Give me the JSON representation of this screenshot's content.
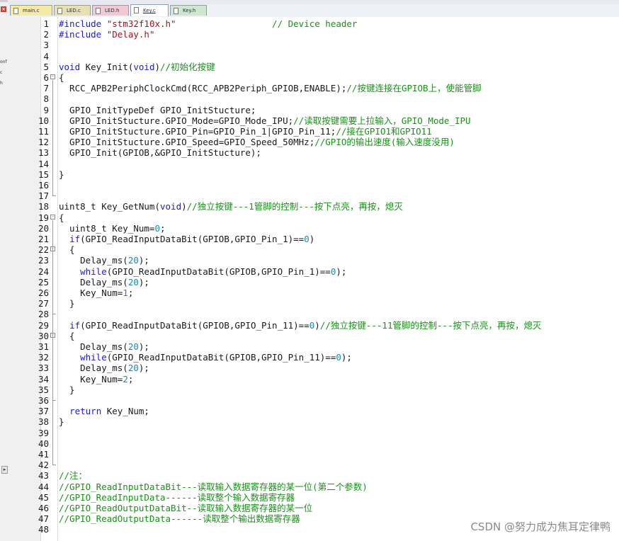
{
  "tabs": [
    {
      "label": "main.c",
      "color": "#f4e9a6",
      "active": false
    },
    {
      "label": "LED.c",
      "color": "#e7e0b3",
      "active": false
    },
    {
      "label": "LED.h",
      "color": "#f1c9d3",
      "active": false
    },
    {
      "label": "Key.c",
      "color": "#c9ddf1",
      "active": true
    },
    {
      "label": "Key.h",
      "color": "#cfe7d0",
      "active": false
    }
  ],
  "left_pane": {
    "close_icon": "×",
    "cut_labels": [
      "onf",
      "c",
      "h"
    ],
    "expand_arrow": "▸"
  },
  "code_lines": [
    {
      "n": "1",
      "segs": [
        [
          "kw",
          "#include "
        ],
        [
          "str",
          "\"stm32f10x.h\""
        ],
        [
          "",
          "                  "
        ],
        [
          "cmt",
          "// Device header"
        ]
      ]
    },
    {
      "n": "2",
      "segs": [
        [
          "kw",
          "#include "
        ],
        [
          "str",
          "\"Delay.h\""
        ]
      ]
    },
    {
      "n": "3",
      "segs": []
    },
    {
      "n": "4",
      "segs": []
    },
    {
      "n": "5",
      "segs": [
        [
          "kw",
          "void"
        ],
        [
          "",
          " Key_Init("
        ],
        [
          "kw",
          "void"
        ],
        [
          "",
          ")"
        ],
        [
          "cmt",
          "//初始化按键"
        ]
      ]
    },
    {
      "n": "6",
      "segs": [
        [
          "",
          "{"
        ]
      ],
      "fold": "-"
    },
    {
      "n": "7",
      "segs": [
        [
          "",
          "  RCC_APB2PeriphClockCmd(RCC_APB2Periph_GPIOB,ENABLE);"
        ],
        [
          "cmt",
          "//按键连接在GPIOB上，使能管脚"
        ]
      ]
    },
    {
      "n": "8",
      "segs": []
    },
    {
      "n": "9",
      "segs": [
        [
          "",
          "  GPIO_InitTypeDef GPIO_InitStucture;"
        ]
      ]
    },
    {
      "n": "10",
      "segs": [
        [
          "",
          "  GPIO_InitStucture.GPIO_Mode=GPIO_Mode_IPU;"
        ],
        [
          "cmt",
          "//读取按键需要上拉输入，GPIO_Mode_IPU"
        ]
      ]
    },
    {
      "n": "11",
      "segs": [
        [
          "",
          "  GPIO_InitStucture.GPIO_Pin=GPIO_Pin_1|GPIO_Pin_11;"
        ],
        [
          "cmt",
          "//接在GPIO1和GPIO11"
        ]
      ]
    },
    {
      "n": "12",
      "segs": [
        [
          "",
          "  GPIO_InitStucture.GPIO_Speed=GPIO_Speed_50MHz;"
        ],
        [
          "cmt",
          "//GPIO的输出速度(输入速度没用)"
        ]
      ]
    },
    {
      "n": "13",
      "segs": [
        [
          "",
          "  GPIO_Init(GPIOB,&GPIO_InitStucture);"
        ]
      ]
    },
    {
      "n": "14",
      "segs": []
    },
    {
      "n": "15",
      "segs": [
        [
          "",
          "}"
        ]
      ]
    },
    {
      "n": "16",
      "segs": []
    },
    {
      "n": "17",
      "segs": []
    },
    {
      "n": "18",
      "segs": [
        [
          "",
          "uint8_t Key_GetNum("
        ],
        [
          "kw",
          "void"
        ],
        [
          "",
          ")"
        ],
        [
          "cmt",
          "//独立按键---1管脚的控制---按下点亮，再按，熄灭"
        ]
      ]
    },
    {
      "n": "19",
      "segs": [
        [
          "",
          "{"
        ]
      ],
      "fold": "-"
    },
    {
      "n": "20",
      "segs": [
        [
          "",
          "  uint8_t Key_Num="
        ],
        [
          "num",
          "0"
        ],
        [
          "",
          ";"
        ]
      ]
    },
    {
      "n": "21",
      "segs": [
        [
          "",
          "  "
        ],
        [
          "kw",
          "if"
        ],
        [
          "",
          "(GPIO_ReadInputDataBit(GPIOB,GPIO_Pin_1)=="
        ],
        [
          "num",
          "0"
        ],
        [
          "",
          ")"
        ]
      ]
    },
    {
      "n": "22",
      "segs": [
        [
          "",
          "  {"
        ]
      ],
      "fold": "-"
    },
    {
      "n": "23",
      "segs": [
        [
          "",
          "    Delay_ms("
        ],
        [
          "num",
          "20"
        ],
        [
          "",
          ");"
        ]
      ]
    },
    {
      "n": "24",
      "segs": [
        [
          "",
          "    "
        ],
        [
          "kw",
          "while"
        ],
        [
          "",
          "(GPIO_ReadInputDataBit(GPIOB,GPIO_Pin_1)=="
        ],
        [
          "num",
          "0"
        ],
        [
          "",
          ");"
        ]
      ]
    },
    {
      "n": "25",
      "segs": [
        [
          "",
          "    Delay_ms("
        ],
        [
          "num",
          "20"
        ],
        [
          "",
          ");"
        ]
      ]
    },
    {
      "n": "26",
      "segs": [
        [
          "",
          "    Key_Num="
        ],
        [
          "num",
          "1"
        ],
        [
          "",
          ";"
        ]
      ]
    },
    {
      "n": "27",
      "segs": [
        [
          "",
          "  }"
        ]
      ]
    },
    {
      "n": "28",
      "segs": []
    },
    {
      "n": "29",
      "segs": [
        [
          "",
          "  "
        ],
        [
          "kw",
          "if"
        ],
        [
          "",
          "(GPIO_ReadInputDataBit(GPIOB,GPIO_Pin_11)=="
        ],
        [
          "num",
          "0"
        ],
        [
          "",
          ")"
        ],
        [
          "cmt",
          "//独立按键---11管脚的控制---按下点亮，再按，熄灭"
        ]
      ]
    },
    {
      "n": "30",
      "segs": [
        [
          "",
          "  {"
        ]
      ],
      "fold": "-"
    },
    {
      "n": "31",
      "segs": [
        [
          "",
          "    Delay_ms("
        ],
        [
          "num",
          "20"
        ],
        [
          "",
          ");"
        ]
      ]
    },
    {
      "n": "32",
      "segs": [
        [
          "",
          "    "
        ],
        [
          "kw",
          "while"
        ],
        [
          "",
          "(GPIO_ReadInputDataBit(GPIOB,GPIO_Pin_11)=="
        ],
        [
          "num",
          "0"
        ],
        [
          "",
          ");"
        ]
      ]
    },
    {
      "n": "33",
      "segs": [
        [
          "",
          "    Delay_ms("
        ],
        [
          "num",
          "20"
        ],
        [
          "",
          ");"
        ]
      ]
    },
    {
      "n": "34",
      "segs": [
        [
          "",
          "    Key_Num="
        ],
        [
          "num",
          "2"
        ],
        [
          "",
          ";"
        ]
      ]
    },
    {
      "n": "35",
      "segs": [
        [
          "",
          "  }"
        ]
      ]
    },
    {
      "n": "36",
      "segs": []
    },
    {
      "n": "37",
      "segs": [
        [
          "",
          "  "
        ],
        [
          "kw",
          "return"
        ],
        [
          "",
          " Key_Num;"
        ]
      ]
    },
    {
      "n": "38",
      "segs": [
        [
          "",
          "}"
        ]
      ]
    },
    {
      "n": "39",
      "segs": []
    },
    {
      "n": "40",
      "segs": []
    },
    {
      "n": "41",
      "segs": []
    },
    {
      "n": "42",
      "segs": []
    },
    {
      "n": "43",
      "segs": [
        [
          "cmt",
          "//注："
        ]
      ]
    },
    {
      "n": "44",
      "segs": [
        [
          "cmt",
          "//GPIO_ReadInputDataBit---读取输入数据寄存器的某一位(第二个参数)"
        ]
      ]
    },
    {
      "n": "45",
      "segs": [
        [
          "cmt",
          "//GPIO_ReadInputData------读取整个输入数据寄存器"
        ]
      ]
    },
    {
      "n": "46",
      "segs": [
        [
          "cmt",
          "//GPIO_ReadOutputDataBit--读取输入数据寄存器的某一位"
        ]
      ]
    },
    {
      "n": "47",
      "segs": [
        [
          "cmt",
          "//GPIO_ReadOutputData------读取整个输出数据寄存器"
        ]
      ]
    },
    {
      "n": "48",
      "segs": []
    }
  ],
  "watermark": "CSDN @努力成为焦耳定律鸭"
}
